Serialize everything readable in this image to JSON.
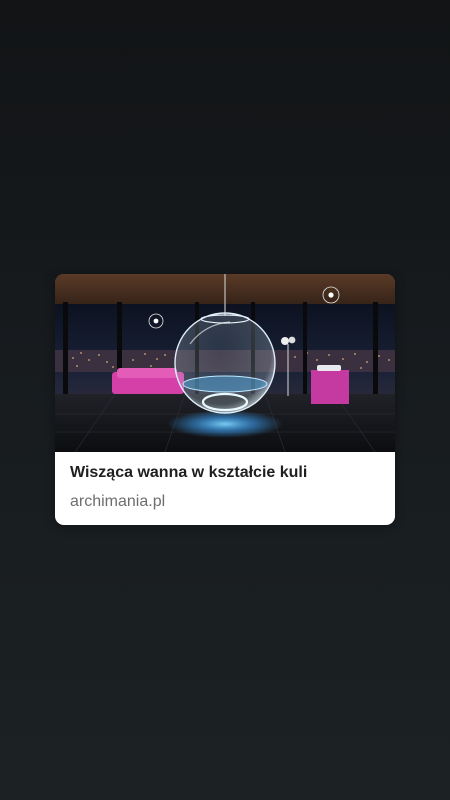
{
  "link_preview": {
    "image_alt": "Wisząca wanna w kształcie kuli",
    "title": "Wisząca wanna w kształcie kuli",
    "source": "archimania.pl"
  },
  "colors": {
    "background_top": "#121416",
    "background_bottom": "#1c2224",
    "card_background": "#ffffff",
    "title_color": "#1f1f1f",
    "source_color": "#6e6e6e",
    "accent_sofa": "#d43fa8",
    "accent_glow": "#3ea8ff"
  }
}
